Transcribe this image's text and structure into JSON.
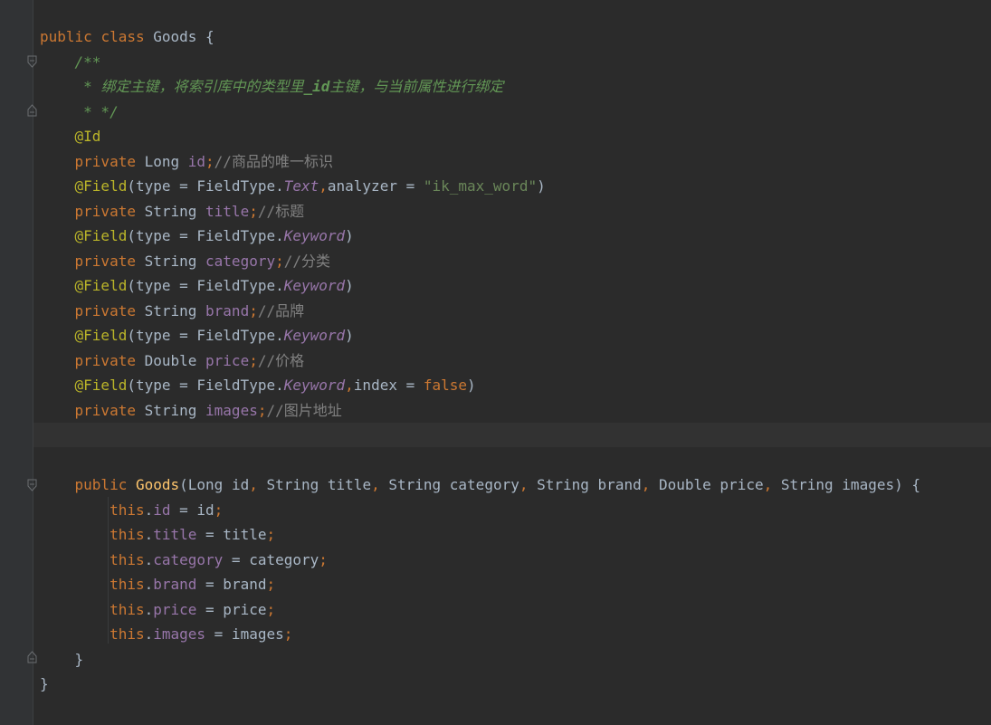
{
  "code": {
    "l1": {
      "kw_public": "public",
      "kw_class": "class",
      "name": "Goods",
      "brace": " {"
    },
    "l2": {
      "text": "/**"
    },
    "l3": {
      "star": " * ",
      "text_a": "绑定主键，将索引库中的类型里",
      "tag": "_id",
      "text_b": "主键，与当前属性进行绑定"
    },
    "l4": {
      "text": " * */"
    },
    "l5": {
      "ann": "@Id"
    },
    "l6": {
      "kw": "private",
      "type": " Long ",
      "field": "id",
      "semi": ";",
      "cmt": "//商品的唯一标识"
    },
    "l7": {
      "ann": "@Field",
      "a": "(type = FieldType.",
      "enum": "Text",
      "comma": ",",
      "b": "analyzer = ",
      "str": "\"ik_max_word\"",
      "c": ")"
    },
    "l8": {
      "kw": "private",
      "type": " String ",
      "field": "title",
      "semi": ";",
      "cmt": "//标题"
    },
    "l9": {
      "ann": "@Field",
      "a": "(type = FieldType.",
      "enum": "Keyword",
      "c": ")"
    },
    "l10": {
      "kw": "private",
      "type": " String ",
      "field": "category",
      "semi": ";",
      "cmt": "//分类"
    },
    "l11": {
      "ann": "@Field",
      "a": "(type = FieldType.",
      "enum": "Keyword",
      "c": ")"
    },
    "l12": {
      "kw": "private",
      "type": " String ",
      "field": "brand",
      "semi": ";",
      "cmt": "//品牌"
    },
    "l13": {
      "ann": "@Field",
      "a": "(type = FieldType.",
      "enum": "Keyword",
      "c": ")"
    },
    "l14": {
      "kw": "private",
      "type": " Double ",
      "field": "price",
      "semi": ";",
      "cmt": "//价格"
    },
    "l15": {
      "ann": "@Field",
      "a": "(type = FieldType.",
      "enum": "Keyword",
      "comma": ",",
      "b": "index = ",
      "kw_false": "false",
      "c": ")"
    },
    "l16": {
      "kw": "private",
      "type": " String ",
      "field": "images",
      "semi": ";",
      "cmt": "//图片地址"
    },
    "l19": {
      "kw": "public",
      "fn": "Goods",
      "p1": "(Long id",
      "c1": ",",
      "p2": " String title",
      "c2": ",",
      "p3": " String category",
      "c3": ",",
      "p4": " String brand",
      "c4": ",",
      "p5": " Double price",
      "c5": ",",
      "p6": " String images) {"
    },
    "l20": {
      "this": "this",
      "dot": ".",
      "field": "id",
      "eq": " = id",
      "semi": ";"
    },
    "l21": {
      "this": "this",
      "dot": ".",
      "field": "title",
      "eq": " = title",
      "semi": ";"
    },
    "l22": {
      "this": "this",
      "dot": ".",
      "field": "category",
      "eq": " = category",
      "semi": ";"
    },
    "l23": {
      "this": "this",
      "dot": ".",
      "field": "brand",
      "eq": " = brand",
      "semi": ";"
    },
    "l24": {
      "this": "this",
      "dot": ".",
      "field": "price",
      "eq": " = price",
      "semi": ";"
    },
    "l25": {
      "this": "this",
      "dot": ".",
      "field": "images",
      "eq": " = images",
      "semi": ";"
    },
    "l26": {
      "text": "}"
    },
    "l27": {
      "text": "}"
    }
  }
}
